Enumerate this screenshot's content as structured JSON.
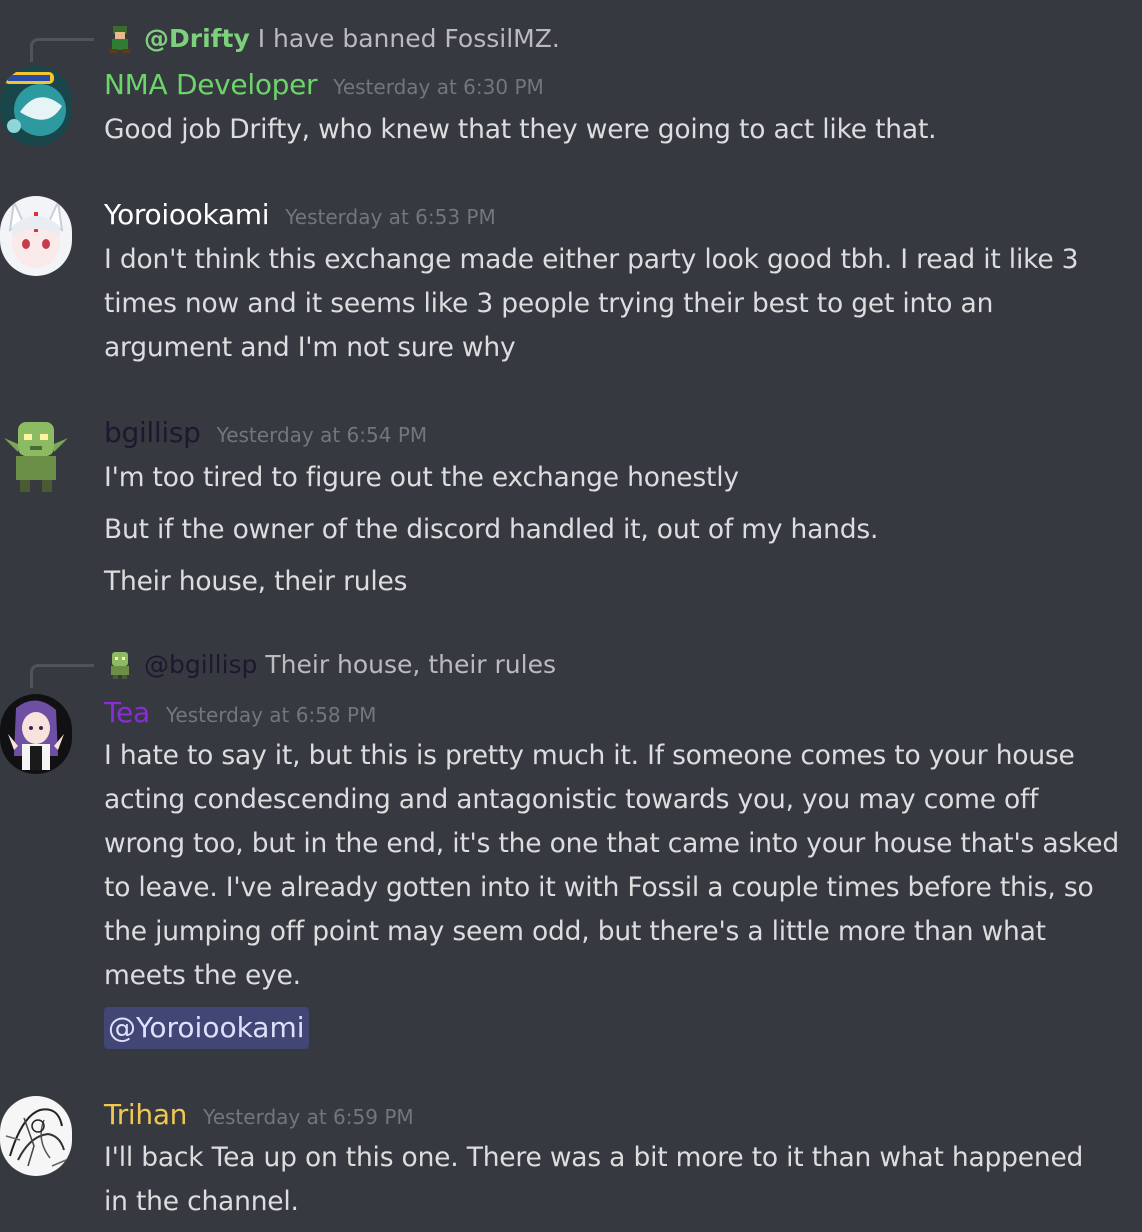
{
  "colors": {
    "background": "#36393f",
    "text": "#dcddde",
    "timestamp": "#72767d",
    "reply_text": "#b9bbbe",
    "drifty": "#7dd07c",
    "nma": "#6cd46a",
    "yoroi": "#ffffff",
    "bgillisp": "#1e1730",
    "tea": "#8b2bd9",
    "trihan": "#f1c752",
    "mention_bg": "#414675",
    "mention_text": "#dee0fc"
  },
  "reply1": {
    "icon": "drifty-avatar-icon",
    "username": "@Drifty",
    "text": "I have banned FossilMZ."
  },
  "messages": [
    {
      "author": "NMA Developer",
      "timestamp": "Yesterday at 6:30 PM",
      "avatar_icon": "pokemon-avatar-icon",
      "lines": [
        "Good job Drifty, who knew that they were going to act like that."
      ]
    },
    {
      "author": "Yoroiookami",
      "timestamp": "Yesterday at 6:53 PM",
      "avatar_icon": "wolf-girl-avatar-icon",
      "lines": [
        "I don't think this exchange made either party look good tbh. I read it like 3",
        "times now and it seems like 3 people trying their best to get into an",
        "argument and I'm not sure why"
      ]
    },
    {
      "author": "bgillisp",
      "timestamp": "Yesterday at 6:54 PM",
      "avatar_icon": "goblin-avatar-icon",
      "lines": [
        "I'm too tired to figure out the exchange honestly",
        "But if the owner of the discord handled it, out of my hands.",
        "Their house, their rules"
      ]
    },
    {
      "author": "Tea",
      "timestamp": "Yesterday at 6:58 PM",
      "avatar_icon": "anime-girl-avatar-icon",
      "lines": [
        "I hate to say it, but this is pretty much it. If someone comes to your house",
        "acting condescending and antagonistic towards you, you may come off",
        "wrong too, but in the end, it's the one that came into your house that's asked",
        "to leave. I've already gotten into it with Fossil a couple times before this, so",
        "the jumping off point may seem odd, but there's a little more than what",
        "meets the eye."
      ],
      "mention": "@Yoroiookami"
    },
    {
      "author": "Trihan",
      "timestamp": "Yesterday at 6:59 PM",
      "avatar_icon": "sketch-avatar-icon",
      "lines": [
        "I'll back Tea up on this one. There was a bit more to it than what happened",
        "in the channel."
      ]
    }
  ],
  "reply2": {
    "icon": "bgillisp-avatar-icon",
    "username": "@bgillisp",
    "text": "Their house, their rules"
  }
}
